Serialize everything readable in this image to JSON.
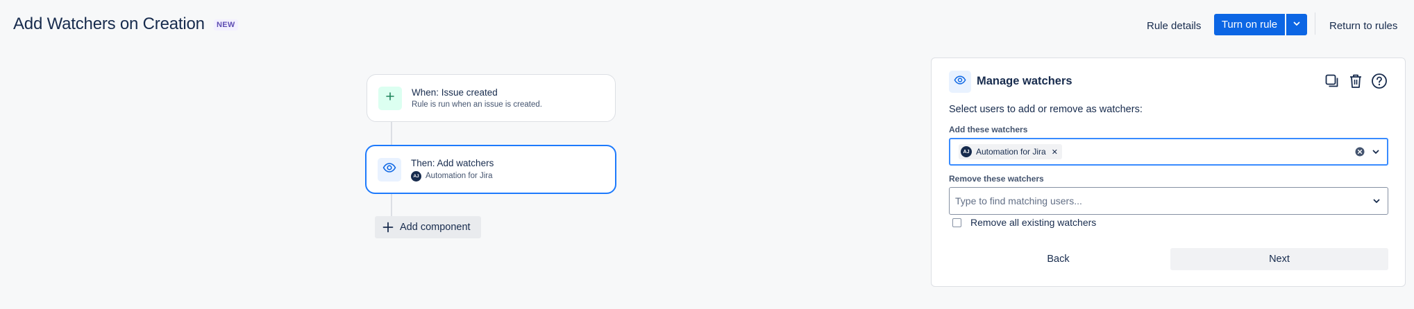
{
  "header": {
    "title": "Add Watchers on Creation",
    "badge": "NEW",
    "rule_details": "Rule details",
    "turn_on": "Turn on rule",
    "return_to_rules": "Return to rules"
  },
  "flow": {
    "trigger": {
      "title": "When: Issue created",
      "subtitle": "Rule is run when an issue is created.",
      "icon": "plus-icon"
    },
    "action": {
      "title": "Then: Add watchers",
      "subtitle": "Automation for Jira",
      "avatar_initials": "AJ",
      "icon": "eye-icon"
    },
    "add_component": "Add component"
  },
  "panel": {
    "title": "Manage watchers",
    "description": "Select users to add or remove as watchers:",
    "add_label": "Add these watchers",
    "add_chip": {
      "initials": "AJ",
      "name": "Automation for Jira"
    },
    "remove_label": "Remove these watchers",
    "remove_placeholder": "Type to find matching users...",
    "remove_all_label": "Remove all existing watchers",
    "back": "Back",
    "next": "Next"
  },
  "colors": {
    "primary": "#0c66e4",
    "selected_border": "#1d7afc",
    "trigger_icon_bg": "#dcfff1",
    "trigger_icon_fg": "#1f845a",
    "action_icon_bg": "#e9f2ff",
    "action_icon_fg": "#0c66e4"
  }
}
